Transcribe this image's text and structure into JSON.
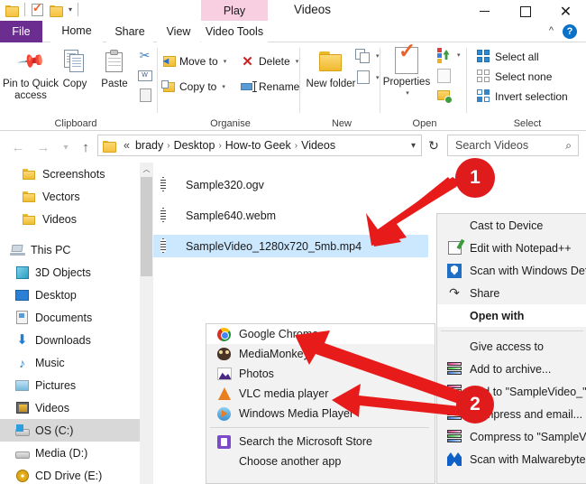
{
  "window": {
    "title": "Videos",
    "minimize_label": "Minimize",
    "maximize_label": "Maximize",
    "close_label": "Close"
  },
  "quick_access_toolbar": {
    "items": [
      {
        "name": "folder-icon",
        "label": ""
      },
      {
        "name": "properties-icon",
        "label": ""
      },
      {
        "name": "new-folder-icon",
        "label": ""
      },
      {
        "name": "customize-dropdown",
        "label": "▾"
      }
    ]
  },
  "tabs": {
    "file": "File",
    "items": [
      "Home",
      "Share",
      "View"
    ],
    "contextual_group": "Play",
    "contextual_tab": "Video Tools",
    "active": "Home",
    "collapse_ribbon_label": "^",
    "help_label": "?"
  },
  "ribbon": {
    "groups": [
      {
        "label": "Clipboard",
        "big_buttons": [
          {
            "label": "Pin to Quick access",
            "icon": "pin-icon"
          },
          {
            "label": "Copy",
            "icon": "copy-icon"
          },
          {
            "label": "Paste",
            "icon": "paste-icon"
          }
        ],
        "small_buttons": [
          {
            "label": "",
            "icon": "cut-icon"
          },
          {
            "label": "",
            "icon": "copy-path-icon"
          },
          {
            "label": "",
            "icon": "paste-shortcut-icon"
          }
        ]
      },
      {
        "label": "Organise",
        "small_buttons": [
          {
            "label": "Move to",
            "icon": "move-to-icon",
            "caret": "▾"
          },
          {
            "label": "Copy to",
            "icon": "copy-to-icon",
            "caret": "▾"
          },
          {
            "label": "Delete",
            "icon": "delete-icon",
            "caret": "▾"
          },
          {
            "label": "Rename",
            "icon": "rename-icon",
            "caret": ""
          }
        ]
      },
      {
        "label": "New",
        "big_buttons": [
          {
            "label": "New folder",
            "icon": "new-folder-icon"
          }
        ],
        "small_buttons": [
          {
            "label": "",
            "icon": "new-item-icon",
            "caret": "▾"
          },
          {
            "label": "",
            "icon": "easy-access-icon",
            "caret": "▾"
          }
        ]
      },
      {
        "label": "Open",
        "big_buttons": [
          {
            "label": "Properties",
            "icon": "properties-icon",
            "caret": "▾"
          }
        ],
        "small_buttons": [
          {
            "label": "",
            "icon": "open-icon",
            "caret": "▾"
          },
          {
            "label": "",
            "icon": "edit-icon",
            "caret": ""
          },
          {
            "label": "",
            "icon": "history-icon",
            "caret": ""
          }
        ]
      },
      {
        "label": "Select",
        "small_buttons": [
          {
            "label": "Select all",
            "icon": "select-all-icon"
          },
          {
            "label": "Select none",
            "icon": "select-none-icon"
          },
          {
            "label": "Invert selection",
            "icon": "invert-selection-icon"
          }
        ]
      }
    ]
  },
  "navigation": {
    "back_label": "←",
    "forward_label": "→",
    "recent_label": "▾",
    "up_label": "↑",
    "refresh_label": "↻",
    "dropdown_label": "▾",
    "overflow_label": "«",
    "breadcrumbs": [
      "brady",
      "Desktop",
      "How-to Geek",
      "Videos"
    ],
    "separator": "›"
  },
  "search": {
    "placeholder": "Search Videos",
    "icon": "search-icon"
  },
  "sidebar": {
    "items": [
      {
        "label": "Screenshots",
        "icon": "folder-icon",
        "selected": false
      },
      {
        "label": "Vectors",
        "icon": "folder-icon",
        "selected": false
      },
      {
        "label": "Videos",
        "icon": "folder-icon",
        "selected": false
      },
      {
        "label": "This PC",
        "icon": "this-pc-icon",
        "selected": false
      },
      {
        "label": "3D Objects",
        "icon": "3d-objects-icon",
        "selected": false
      },
      {
        "label": "Desktop",
        "icon": "desktop-icon",
        "selected": false
      },
      {
        "label": "Documents",
        "icon": "documents-icon",
        "selected": false
      },
      {
        "label": "Downloads",
        "icon": "downloads-icon",
        "selected": false
      },
      {
        "label": "Music",
        "icon": "music-icon",
        "selected": false
      },
      {
        "label": "Pictures",
        "icon": "pictures-icon",
        "selected": false
      },
      {
        "label": "Videos",
        "icon": "videos-icon",
        "selected": false
      },
      {
        "label": "OS (C:)",
        "icon": "drive-icon",
        "selected": true
      },
      {
        "label": "Media (D:)",
        "icon": "drive-icon",
        "selected": false
      },
      {
        "label": "CD Drive (E:)",
        "icon": "cd-drive-icon",
        "selected": false
      }
    ]
  },
  "files": [
    {
      "name": "Sample320.ogv",
      "icon": "video-file-icon",
      "selected": false
    },
    {
      "name": "Sample640.webm",
      "icon": "video-file-icon",
      "selected": false
    },
    {
      "name": "SampleVideo_1280x720_5mb.mp4",
      "icon": "video-file-icon",
      "selected": true
    }
  ],
  "context_menu": {
    "items": [
      {
        "label": "Cast to Device",
        "icon": "",
        "bold": false
      },
      {
        "label": "Edit with Notepad++",
        "icon": "notepad-plus-plus-icon",
        "bold": false
      },
      {
        "label": "Scan with Windows Def",
        "icon": "windows-defender-icon",
        "bold": false
      },
      {
        "label": "Share",
        "icon": "share-icon",
        "bold": false
      },
      {
        "label": "Open with",
        "icon": "",
        "bold": true
      },
      {
        "label": "Give access to",
        "icon": "",
        "bold": false
      },
      {
        "label": "Add to archive...",
        "icon": "winrar-icon",
        "bold": false
      },
      {
        "label": "Add to \"SampleVideo_\"",
        "icon": "winrar-icon",
        "bold": false
      },
      {
        "label": "Compress and email...",
        "icon": "winrar-icon",
        "bold": false
      },
      {
        "label": "Compress to \"SampleV",
        "icon": "winrar-icon",
        "bold": false
      },
      {
        "label": "Scan with Malwarebyte",
        "icon": "malwarebytes-icon",
        "bold": false
      }
    ]
  },
  "open_with_submenu": {
    "items": [
      {
        "label": "Google Chrome",
        "icon": "chrome-icon",
        "highlighted": true
      },
      {
        "label": "MediaMonkey",
        "icon": "mediamonkey-icon",
        "highlighted": false
      },
      {
        "label": "Photos",
        "icon": "photos-icon",
        "highlighted": false
      },
      {
        "label": "VLC media player",
        "icon": "vlc-icon",
        "highlighted": false
      },
      {
        "label": "Windows Media Player",
        "icon": "windows-media-player-icon",
        "highlighted": false
      }
    ],
    "footer_items": [
      {
        "label": "Search the Microsoft Store",
        "icon": "microsoft-store-icon"
      },
      {
        "label": "Choose another app",
        "icon": ""
      }
    ]
  },
  "annotations": {
    "badges": [
      {
        "number": "1",
        "color": "#e01b1b"
      },
      {
        "number": "2",
        "color": "#e01b1b"
      }
    ],
    "arrow_color": "#e81b1b"
  }
}
